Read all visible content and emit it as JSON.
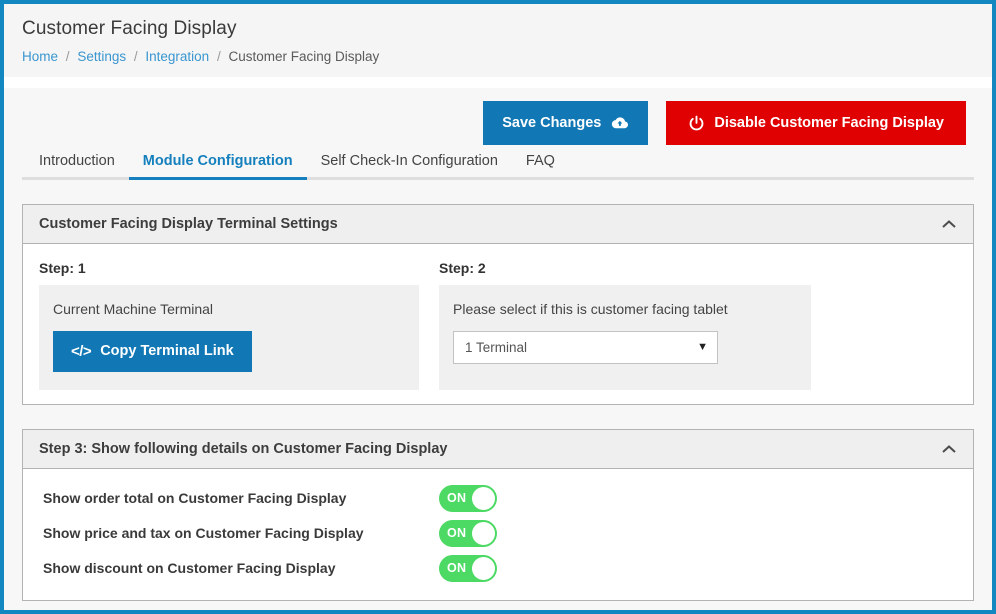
{
  "header": {
    "title": "Customer Facing Display",
    "breadcrumb": [
      {
        "label": "Home",
        "link": true
      },
      {
        "label": "Settings",
        "link": true
      },
      {
        "label": "Integration",
        "link": true
      },
      {
        "label": "Customer Facing Display",
        "link": false
      }
    ],
    "separator": "/"
  },
  "actions": {
    "save_label": "Save Changes",
    "save_icon": "cloud-upload-icon",
    "save_color": "#1178b5",
    "disable_label": "Disable Customer Facing Display",
    "disable_icon": "power-icon",
    "disable_color": "#e00202"
  },
  "tabs": [
    {
      "label": "Introduction",
      "active": false
    },
    {
      "label": "Module Configuration",
      "active": true
    },
    {
      "label": "Self Check-In Configuration",
      "active": false
    },
    {
      "label": "FAQ",
      "active": false
    }
  ],
  "panel_terminal": {
    "title": "Customer Facing Display Terminal Settings",
    "collapse_icon": "chevron-up-icon",
    "step1": {
      "label": "Step: 1",
      "caption": "Current Machine Terminal",
      "button_label": "Copy Terminal Link",
      "button_icon": "code-icon",
      "button_glyph": "</>"
    },
    "step2": {
      "label": "Step: 2",
      "caption": "Please select if this is customer facing tablet",
      "select_value": "1 Terminal",
      "select_caret": "▼"
    }
  },
  "panel_details": {
    "title": "Step 3: Show following details on Customer Facing Display",
    "collapse_icon": "chevron-up-icon",
    "toggle_on_color": "#4cd964",
    "rows": [
      {
        "label": "Show order total on Customer Facing Display",
        "state": "ON"
      },
      {
        "label": "Show price and tax on Customer Facing Display",
        "state": "ON"
      },
      {
        "label": "Show discount on Customer Facing Display",
        "state": "ON"
      }
    ]
  },
  "theme": {
    "window_border": "#1287c0",
    "accent": "#1580bd",
    "page_bg": "#f7f7f7"
  }
}
